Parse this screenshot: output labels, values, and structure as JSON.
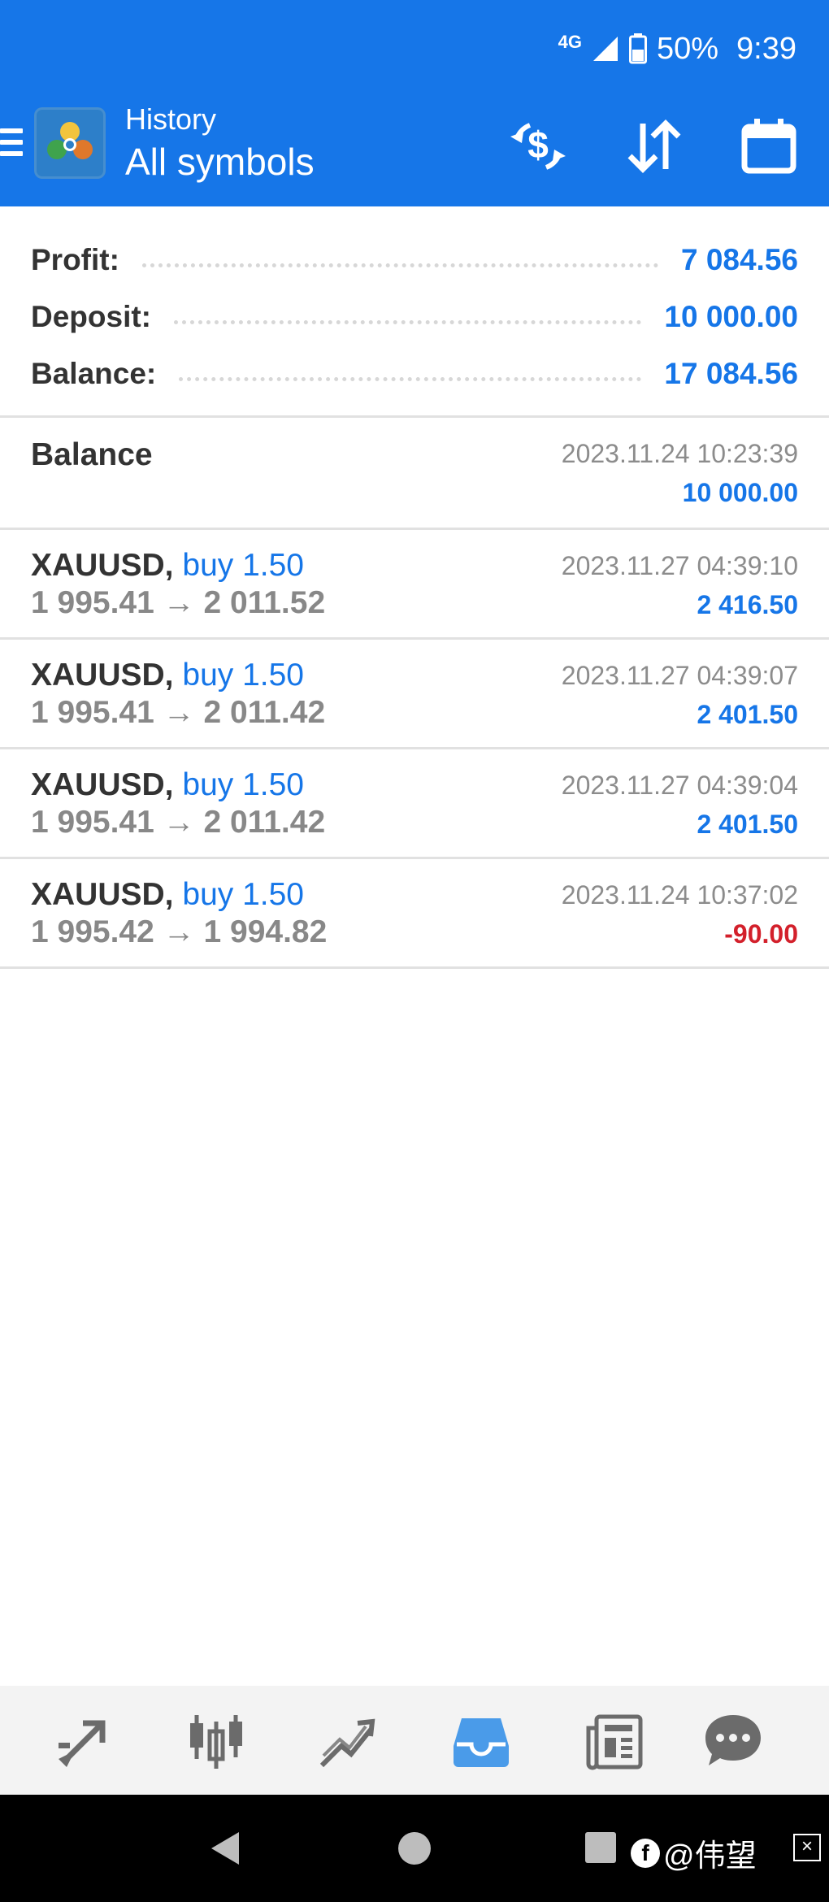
{
  "status_bar": {
    "network": "4G",
    "battery": "50%",
    "time": "9:39"
  },
  "header": {
    "subtitle": "History",
    "title": "All symbols",
    "icons": [
      "menu-icon",
      "currency-exchange-icon",
      "sort-icon",
      "calendar-icon"
    ]
  },
  "summary": {
    "profit_label": "Profit:",
    "profit_value": "7 084.56",
    "deposit_label": "Deposit:",
    "deposit_value": "10 000.00",
    "balance_label": "Balance:",
    "balance_value": "17 084.56"
  },
  "balance_entry": {
    "label": "Balance",
    "time": "2023.11.24 10:23:39",
    "amount": "10 000.00"
  },
  "deals": [
    {
      "symbol": "XAUUSD,",
      "type": "buy 1.50",
      "prices": "1 995.41 → 2 011.52",
      "time": "2023.11.27 04:39:10",
      "profit": "2 416.50"
    },
    {
      "symbol": "XAUUSD,",
      "type": "buy 1.50",
      "prices": "1 995.41 → 2 011.42",
      "time": "2023.11.27 04:39:07",
      "profit": "2 401.50"
    },
    {
      "symbol": "XAUUSD,",
      "type": "buy 1.50",
      "prices": "1 995.41 → 2 011.42",
      "time": "2023.11.27 04:39:04",
      "profit": "2 401.50"
    },
    {
      "symbol": "XAUUSD,",
      "type": "buy 1.50",
      "prices": "1 995.42 → 1 994.82",
      "time": "2023.11.24 10:37:02",
      "profit": "-90.00"
    }
  ],
  "bottom_nav": {
    "items": [
      "quotes-icon",
      "chart-icon",
      "trade-icon",
      "history-icon",
      "news-icon",
      "messages-icon"
    ],
    "active": "history-icon"
  },
  "watermark": {
    "text": "@伟望"
  },
  "colors": {
    "accent": "#1676e8",
    "negative": "#d3202b",
    "header_bg": "#1676e8"
  }
}
